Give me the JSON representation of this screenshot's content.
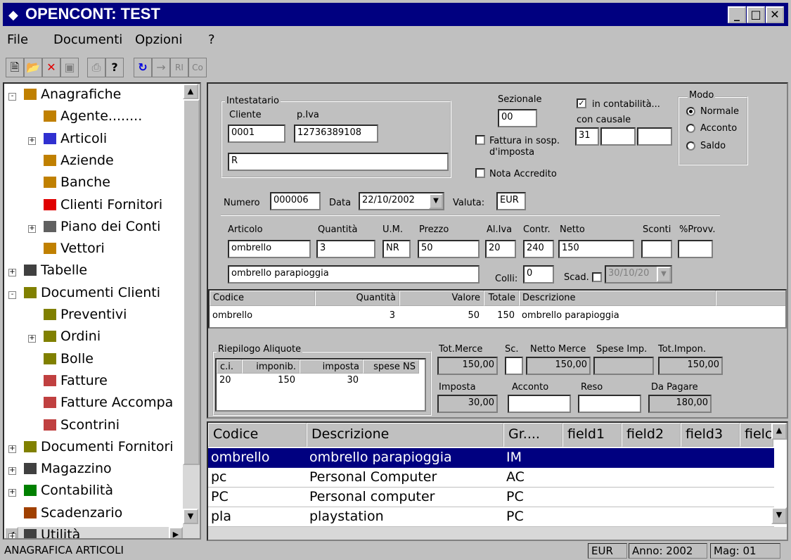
{
  "app": {
    "title": "OPENCONT: TEST"
  },
  "menu": [
    "File",
    "Documenti",
    "Opzioni",
    "?"
  ],
  "tree": {
    "items": [
      {
        "label": "Anagrafiche",
        "expander": "-"
      },
      {
        "label": "Agente........",
        "expander": ""
      },
      {
        "label": "Articoli",
        "expander": "+"
      },
      {
        "label": "Aziende",
        "expander": ""
      },
      {
        "label": "Banche",
        "expander": ""
      },
      {
        "label": "Clienti Fornitori",
        "expander": ""
      },
      {
        "label": "Piano dei Conti",
        "expander": "+"
      },
      {
        "label": "Vettori",
        "expander": ""
      },
      {
        "label": "Tabelle",
        "expander": "+"
      },
      {
        "label": "Documenti Clienti",
        "expander": "-"
      },
      {
        "label": "Preventivi",
        "expander": ""
      },
      {
        "label": "Ordini",
        "expander": "+"
      },
      {
        "label": "Bolle",
        "expander": ""
      },
      {
        "label": "Fatture",
        "expander": ""
      },
      {
        "label": "Fatture Accompa",
        "expander": ""
      },
      {
        "label": "Scontrini",
        "expander": ""
      },
      {
        "label": "Documenti Fornitori",
        "expander": "+"
      },
      {
        "label": "Magazzino",
        "expander": "+"
      },
      {
        "label": "Contabilità",
        "expander": "+"
      },
      {
        "label": "Scadenzario",
        "expander": ""
      },
      {
        "label": "Utilità",
        "expander": "+"
      }
    ]
  },
  "form": {
    "intestatario": "Intestatario",
    "cliente_label": "Cliente",
    "piva_label": "p.Iva",
    "cliente": "0001",
    "piva": "12736389108",
    "nome": "R",
    "sezionale_label": "Sezionale",
    "sezionale": "00",
    "in_contabilita": "in contabilità...",
    "con_causale": "con causale",
    "causale": "31",
    "fattura_sosp": "Fattura in sosp. d'imposta",
    "nota_accredito": "Nota Accredito",
    "modo_label": "Modo",
    "modo": [
      "Normale",
      "Acconto",
      "Saldo"
    ],
    "numero_label": "Numero",
    "numero": "000006",
    "data_label": "Data",
    "data": "22/10/2002",
    "valuta_label": "Valuta:",
    "valuta": "EUR",
    "articolo_label": "Articolo",
    "quantita_label": "Quantità",
    "um_label": "U.M.",
    "prezzo_label": "Prezzo",
    "aliva_label": "Al.Iva",
    "contr_label": "Contr.",
    "netto_label": "Netto",
    "sconti_label": "Sconti",
    "provv_label": "%Provv.",
    "articolo": "ombrello",
    "quantita": "3",
    "um": "NR",
    "prezzo": "50",
    "aliva": "20",
    "contr": "240",
    "netto": "150",
    "descr": "ombrello parapioggia",
    "colli_label": "Colli:",
    "colli": "0",
    "scad_label": "Scad.",
    "scad": "30/10/20"
  },
  "righe": {
    "headers": [
      "Codice",
      "Quantità",
      "Valore",
      "Totale",
      "Descrizione"
    ],
    "rows": [
      {
        "codice": "ombrello",
        "quantita": "3",
        "valore": "50",
        "totale": "150",
        "descrizione": "ombrello parapioggia"
      }
    ]
  },
  "riepilogo": {
    "title": "Riepilogo Aliquote",
    "headers": [
      "c.i.",
      "imponib.",
      "imposta",
      "spese NS"
    ],
    "rows": [
      {
        "ci": "20",
        "imponib": "150",
        "imposta": "30",
        "spese": ""
      }
    ]
  },
  "totali": {
    "tot_merce_label": "Tot.Merce",
    "sc_label": "Sc.",
    "netto_merce_label": "Netto Merce",
    "spese_imp_label": "Spese Imp.",
    "tot_impon_label": "Tot.Impon.",
    "tot_merce": "150,00",
    "netto_merce": "150,00",
    "tot_impon": "150,00",
    "imposta_label": "Imposta",
    "acconto_label": "Acconto",
    "reso_label": "Reso",
    "da_pagare_label": "Da Pagare",
    "imposta": "30,00",
    "da_pagare": "180,00"
  },
  "lookup": {
    "headers": [
      "Codice",
      "Descrizione",
      "Gr....",
      "field1",
      "field2",
      "field3",
      "fielc"
    ],
    "rows": [
      {
        "codice": "ombrello",
        "descr": "ombrello parapioggia",
        "gr": "IM"
      },
      {
        "codice": "pc",
        "descr": "Personal Computer",
        "gr": "AC"
      },
      {
        "codice": "PC",
        "descr": "Personal computer",
        "gr": "PC"
      },
      {
        "codice": "pla",
        "descr": "playstation",
        "gr": "PC"
      }
    ]
  },
  "status": {
    "left": "ANAGRAFICA ARTICOLI",
    "valuta": "EUR",
    "anno": "Anno: 2002",
    "mag": "Mag: 01"
  }
}
